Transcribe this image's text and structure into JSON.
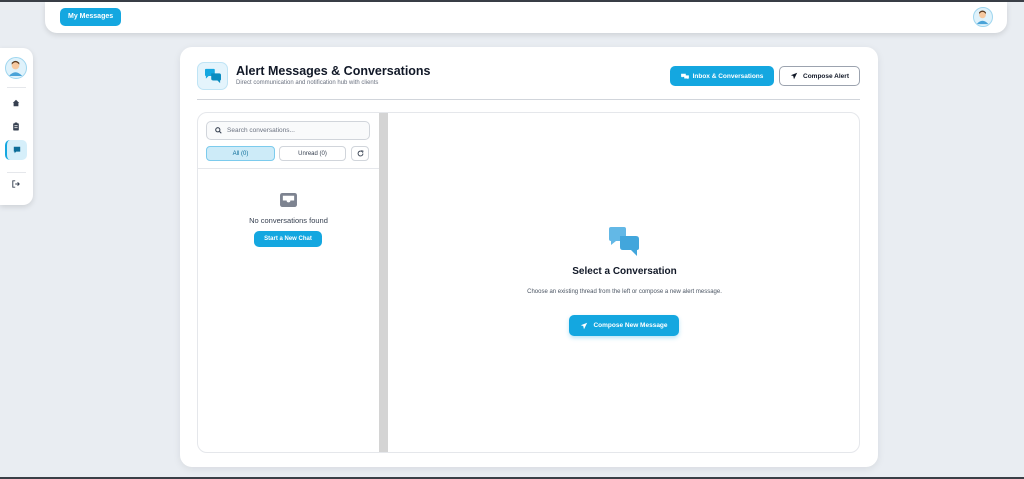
{
  "topbar": {
    "my_messages_label": "My Messages"
  },
  "rail": {
    "items": [
      {
        "name": "home-icon"
      },
      {
        "name": "clipboard-icon"
      },
      {
        "name": "chat-icon",
        "active": true
      },
      {
        "name": "logout-icon"
      }
    ]
  },
  "header": {
    "title": "Alert Messages & Conversations",
    "subtitle": "Direct communication and notification hub with clients",
    "inbox_label": "Inbox & Conversations",
    "compose_label": "Compose Alert"
  },
  "conversations": {
    "search_placeholder": "Search conversations...",
    "filters": {
      "all": "All (0)",
      "unread": "Unread (0)"
    },
    "empty_text": "No conversations found",
    "new_chat_label": "Start a New Chat"
  },
  "detail": {
    "title": "Select a Conversation",
    "description": "Choose an existing thread from the left or compose a new alert message.",
    "compose_new_label": "Compose New Message"
  },
  "colors": {
    "accent": "#14a7e0",
    "accent_light": "#cdebf8",
    "background": "#e9edf2"
  }
}
